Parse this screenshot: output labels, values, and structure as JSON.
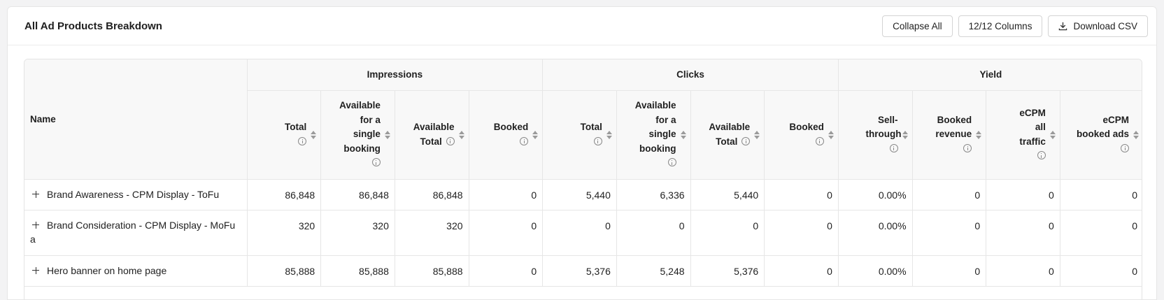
{
  "title": "All Ad Products Breakdown",
  "actions": {
    "collapse_label": "Collapse All",
    "columns_label": "12/12 Columns",
    "download_label": "Download CSV"
  },
  "table": {
    "name_header": "Name",
    "groups": [
      "Impressions",
      "Clicks",
      "Yield"
    ],
    "columns": [
      {
        "label": "Total",
        "info": true
      },
      {
        "label": "Available for a single booking",
        "info": true
      },
      {
        "label": "Available Total",
        "info": true
      },
      {
        "label": "Booked",
        "info": true
      },
      {
        "label": "Total",
        "info": true
      },
      {
        "label": "Available for a single booking",
        "info": true
      },
      {
        "label": "Available Total",
        "info": true
      },
      {
        "label": "Booked",
        "info": true
      },
      {
        "label": "Sell-through",
        "info": true
      },
      {
        "label": "Booked revenue",
        "info": true
      },
      {
        "label": "eCPM all traffic",
        "info": true
      },
      {
        "label": "eCPM booked ads",
        "info": true
      }
    ],
    "rows": [
      {
        "name": "Brand Awareness - CPM Display - ToFu",
        "values": [
          "86,848",
          "86,848",
          "86,848",
          "0",
          "5,440",
          "6,336",
          "5,440",
          "0",
          "0.00%",
          "0",
          "0",
          "0"
        ]
      },
      {
        "name": "Brand Consideration - CPM Display - MoFu a",
        "values": [
          "320",
          "320",
          "320",
          "0",
          "0",
          "0",
          "0",
          "0",
          "0.00%",
          "0",
          "0",
          "0"
        ]
      },
      {
        "name": "Hero banner on home page",
        "values": [
          "85,888",
          "85,888",
          "85,888",
          "0",
          "5,376",
          "5,248",
          "5,376",
          "0",
          "0.00%",
          "0",
          "0",
          "0"
        ]
      }
    ]
  }
}
